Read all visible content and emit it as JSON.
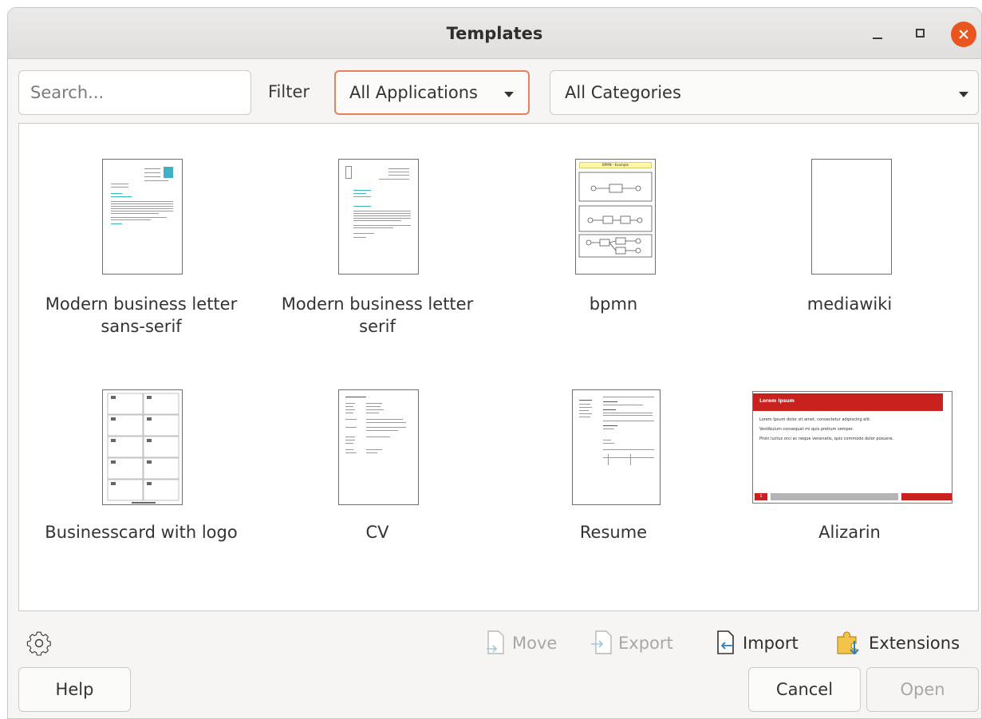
{
  "window": {
    "title": "Templates"
  },
  "search": {
    "placeholder": "Search..."
  },
  "filter": {
    "label": "Filter",
    "applications": "All Applications",
    "categories": "All Categories"
  },
  "templates": [
    {
      "label_line1": "Modern business letter",
      "label_line2": "sans-serif"
    },
    {
      "label_line1": "Modern business letter",
      "label_line2": "serif"
    },
    {
      "label_line1": "bpmn",
      "label_line2": ""
    },
    {
      "label_line1": "mediawiki",
      "label_line2": ""
    },
    {
      "label_line1": "Businesscard with logo",
      "label_line2": ""
    },
    {
      "label_line1": "CV",
      "label_line2": ""
    },
    {
      "label_line1": "Resume",
      "label_line2": ""
    },
    {
      "label_line1": "Alizarin",
      "label_line2": ""
    }
  ],
  "thumbnail_text": {
    "alizarin_title": "Lorem Ipsum",
    "alizarin_line1": "Lorem Ipsum dolor sit amet, consectetur adipiscing elit.",
    "alizarin_line2": "Vestibulum consequat mi quis pretium semper.",
    "alizarin_line3": "Proin luctus orci ac neque venenatis, quis commodo dolor posuere.",
    "alizarin_page": "1",
    "bpmn_title": "BPMN - Example"
  },
  "actions": {
    "move": "Move",
    "export": "Export",
    "import": "Import",
    "extensions": "Extensions"
  },
  "buttons": {
    "help": "Help",
    "cancel": "Cancel",
    "open": "Open"
  },
  "colors": {
    "accent_orange": "#e9541f",
    "alizarin_red": "#c9211e",
    "focus_border": "#e9805d"
  }
}
